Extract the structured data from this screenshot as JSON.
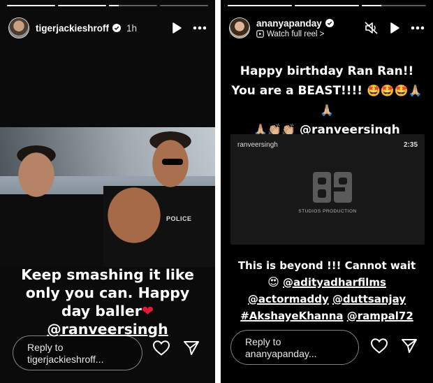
{
  "left_story": {
    "username": "tigerjackieshroff",
    "time": "1h",
    "progress": [
      1,
      1,
      0.2,
      0
    ],
    "photo_tag": "POLICE",
    "caption_text": "Keep smashing it like only you can. Happy day baller",
    "caption_emoji": "❤",
    "caption_mention": "@ranveersingh",
    "reply_line1": "Reply to",
    "reply_line2": "tigerjackieshroff..."
  },
  "right_story": {
    "username": "ananyapanday",
    "subtitle": "Watch full reel >",
    "progress": [
      1,
      1,
      0.3
    ],
    "top_text": "Happy birthday Ran Ran!! You are a BEAST!!!!",
    "top_emojis_1": "🤩🤩🤩🙏🏼🙏🏼",
    "top_emojis_2": "🙏🏼👏🏼👏🏼",
    "top_mention": "@ranveersingh",
    "reel_user": "ranveersingh",
    "reel_duration": "2:35",
    "reel_studio": "STUDIOS PRODUCTION",
    "bottom_line1": "This is beyond !!! Cannot wait",
    "bottom_emoji": "😍",
    "bottom_mention1": "@adityadharfilms",
    "bottom_mention2": "@actormaddy",
    "bottom_mention3": "@duttsanjay",
    "bottom_mention4": "#AkshayeKhanna",
    "bottom_mention5": "@rampal72",
    "reply_line1": "Reply to",
    "reply_line2": "ananyapanday..."
  },
  "colors": {
    "background": "#000000",
    "heart": "#e0183a"
  },
  "icons": [
    "verified-badge-icon",
    "play-icon",
    "more-icon",
    "mute-icon",
    "heart-icon",
    "send-icon"
  ]
}
